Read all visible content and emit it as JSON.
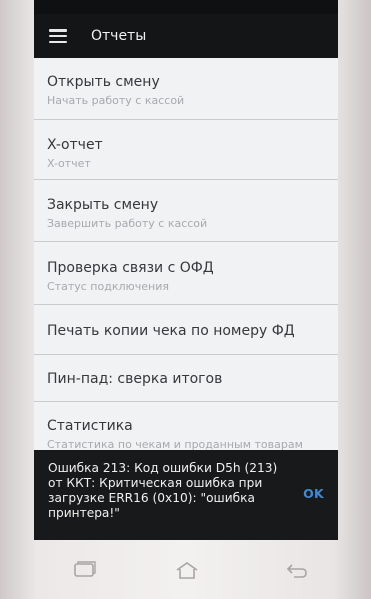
{
  "appbar": {
    "title": "Отчеты",
    "menu_icon": "hamburger-menu-icon"
  },
  "menu_items": [
    {
      "title": "Открыть смену",
      "subtitle": "Начать работу с кассой"
    },
    {
      "title": "X-отчет",
      "subtitle": "X-отчет"
    },
    {
      "title": "Закрыть смену",
      "subtitle": "Завершить работу с кассой"
    },
    {
      "title": "Проверка связи с ОФД",
      "subtitle": "Статус подключения"
    },
    {
      "title": "Печать копии чека по номеру ФД",
      "subtitle": ""
    },
    {
      "title": "Пин-пад: сверка итогов",
      "subtitle": ""
    },
    {
      "title": "Статистика",
      "subtitle": "Статистика по чекам и проданным товарам"
    }
  ],
  "snackbar": {
    "message": "Ошибка 213: Код ошибки D5h (213) от ККТ: Критическая ошибка при загрузке ERR16 (0x10): \"ошибка принтера!\"",
    "action": "OK"
  },
  "hardware_buttons": [
    "recent-apps-icon",
    "home-icon",
    "back-icon"
  ],
  "colors": {
    "appbar": "#141517",
    "list_background": "#f1f2f4",
    "snackbar": "#18191b",
    "action_accent": "#3d8bd6"
  }
}
